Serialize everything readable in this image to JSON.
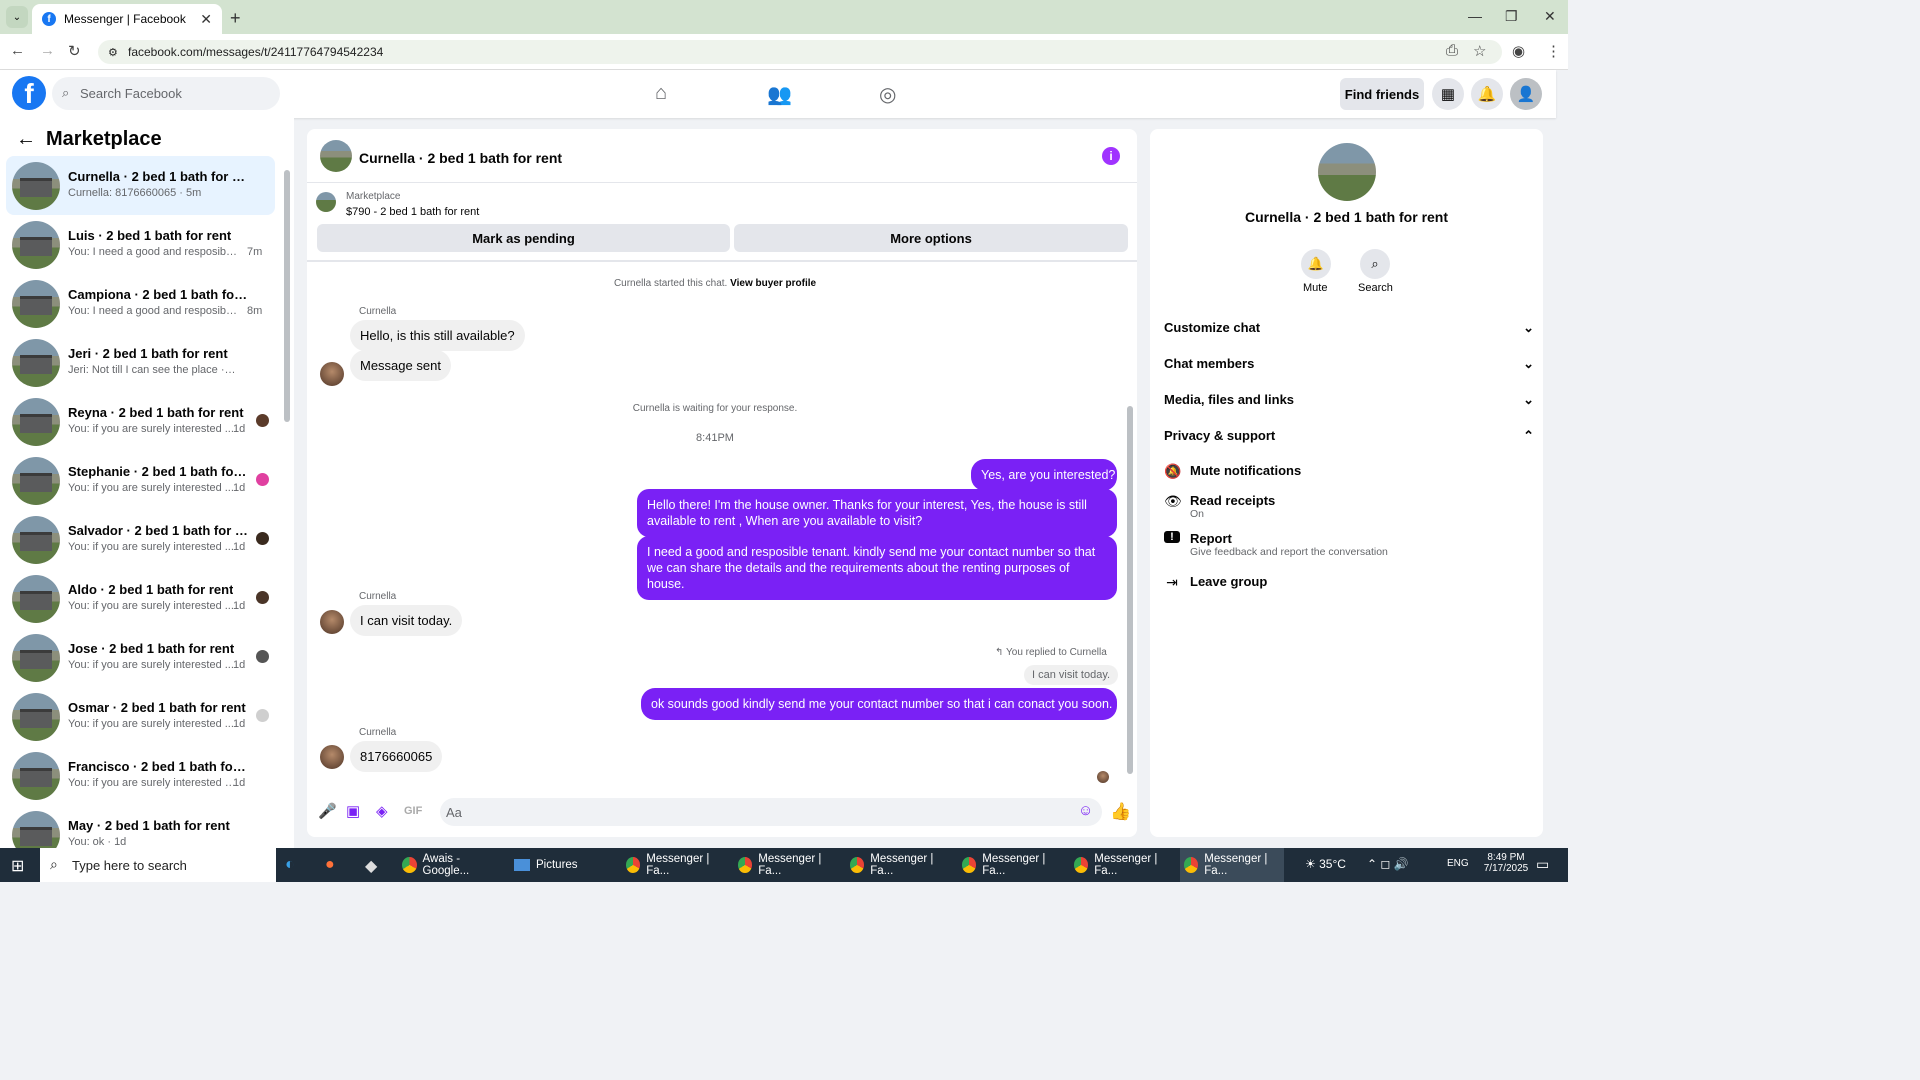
{
  "browser": {
    "tab_title": "Messenger | Facebook",
    "url": "facebook.com/messages/t/24117764794542234"
  },
  "fb": {
    "search_placeholder": "Search Facebook",
    "find_friends": "Find friends"
  },
  "sidebar": {
    "title": "Marketplace",
    "conversations": [
      {
        "name": "Curnella · 2 bed 1 bath for rent",
        "preview": "Curnella: 8176660065 · 5m",
        "time": "",
        "active": true
      },
      {
        "name": "Luis · 2 bed 1 bath for rent",
        "preview": "You: I need a good and resposible ...",
        "time": "7m"
      },
      {
        "name": "Campiona · 2 bed 1 bath for rent",
        "preview": "You: I need a good and resposible ...",
        "time": "8m"
      },
      {
        "name": "Jeri · 2 bed 1 bath for rent",
        "preview": "Jeri: Not till I can see the place · 1d",
        "time": ""
      },
      {
        "name": "Reyna · 2 bed 1 bath for rent",
        "preview": "You: if you are surely interested ...",
        "time": "1d"
      },
      {
        "name": "Stephanie · 2 bed 1 bath for re...",
        "preview": "You: if you are surely interested ...",
        "time": "1d"
      },
      {
        "name": "Salvador · 2 bed 1 bath for rent",
        "preview": "You: if you are surely interested ...",
        "time": "1d"
      },
      {
        "name": "Aldo · 2 bed 1 bath for rent",
        "preview": "You: if you are surely interested ...",
        "time": "1d"
      },
      {
        "name": "Jose · 2 bed 1 bath for rent",
        "preview": "You: if you are surely interested ...",
        "time": "1d"
      },
      {
        "name": "Osmar · 2 bed 1 bath for rent",
        "preview": "You: if you are surely interested ...",
        "time": "1d"
      },
      {
        "name": "Francisco · 2 bed 1 bath for rent",
        "preview": "You: if you are surely interested kin...",
        "time": "1d"
      },
      {
        "name": "May · 2 bed 1 bath for rent",
        "preview": "You: ok · 1d",
        "time": ""
      }
    ]
  },
  "chat": {
    "title": "Curnella · 2 bed 1 bath for rent",
    "marketplace_label": "Marketplace",
    "listing": "$790 - 2 bed 1 bath for rent",
    "mark_pending": "Mark as pending",
    "more_options": "More options",
    "started_text": "Curnella started this chat.",
    "view_buyer": "View buyer profile",
    "sender_name": "Curnella",
    "msg1": "Hello, is this still available?",
    "msg2": "Message sent",
    "waiting": "Curnella is waiting for your response.",
    "time_divider": "8:41PM",
    "out1": "Yes, are you interested?",
    "out2": "Hello there! I'm the house owner. Thanks for your interest, Yes, the house is still available to rent , When are you available to visit?",
    "out3": "I need a good and resposible tenant.  kindly send me your contact number so that we can share the details and the requirements about the renting purposes of house.",
    "msg3": "I can visit today.",
    "replied_label": "You replied to Curnella",
    "quoted": "I can visit today.",
    "out4": "ok sounds good kindly  send me your contact number so that i can conact you soon.",
    "msg4": "8176660065",
    "composer_placeholder": "Aa"
  },
  "details": {
    "title": "Curnella · 2 bed 1 bath for rent",
    "mute": "Mute",
    "search": "Search",
    "sections": [
      "Customize chat",
      "Chat members",
      "Media, files and links",
      "Privacy & support"
    ],
    "mute_notifications": "Mute notifications",
    "read_receipts": "Read receipts",
    "read_receipts_state": "On",
    "report": "Report",
    "report_desc": "Give feedback and report the conversation",
    "leave_group": "Leave group"
  },
  "taskbar": {
    "search_placeholder": "Type here to search",
    "items": [
      "Awais - Google...",
      "Pictures",
      "Messenger | Fa...",
      "Messenger | Fa...",
      "Messenger | Fa...",
      "Messenger | Fa...",
      "Messenger | Fa...",
      "Messenger | Fa..."
    ],
    "temp": "35°C",
    "lang": "ENG",
    "time": "8:49 PM",
    "date": "7/17/2025"
  }
}
